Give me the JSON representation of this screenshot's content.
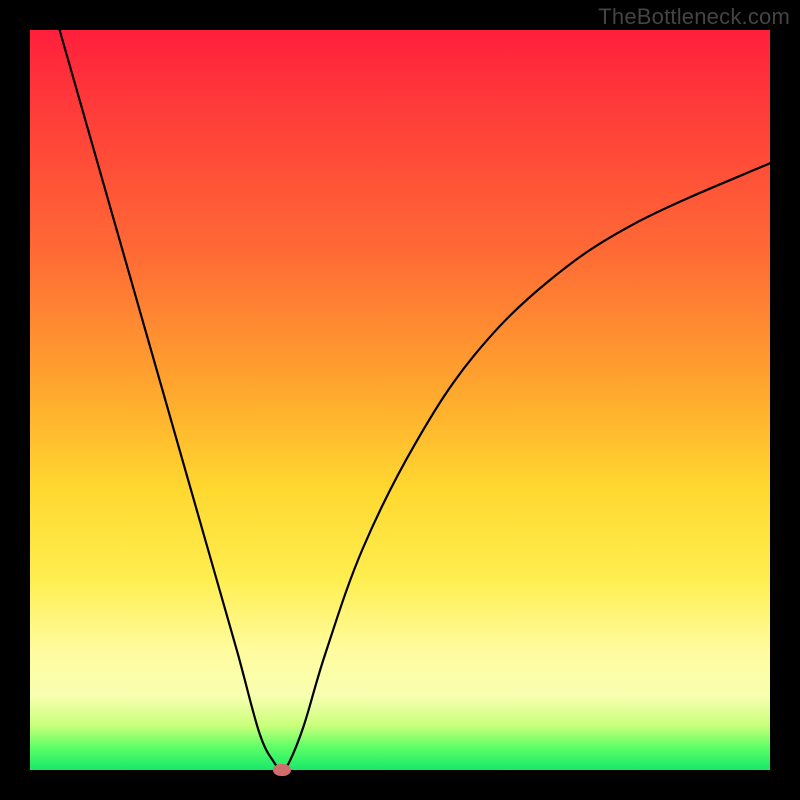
{
  "watermark": "TheBottleneck.com",
  "chart_data": {
    "type": "line",
    "title": "",
    "xlabel": "",
    "ylabel": "",
    "xlim": [
      0,
      100
    ],
    "ylim": [
      0,
      100
    ],
    "background_gradient": {
      "top_color": "#ff1f3c",
      "mid_colors": [
        "#ff6a35",
        "#ffd82f",
        "#fffca0"
      ],
      "bottom_color": "#17e86a"
    },
    "series": [
      {
        "name": "bottleneck-curve",
        "x": [
          4,
          8,
          12,
          16,
          20,
          24,
          28,
          31,
          33,
          34,
          35,
          37,
          40,
          45,
          52,
          60,
          70,
          82,
          100
        ],
        "y": [
          100,
          86,
          72,
          58,
          44,
          30,
          16,
          5,
          1,
          0,
          1,
          6,
          16,
          30,
          44,
          56,
          66,
          74,
          82
        ]
      }
    ],
    "marker": {
      "x": 34,
      "y": 0,
      "color": "#d26d6d"
    },
    "grid": false,
    "legend": false
  }
}
